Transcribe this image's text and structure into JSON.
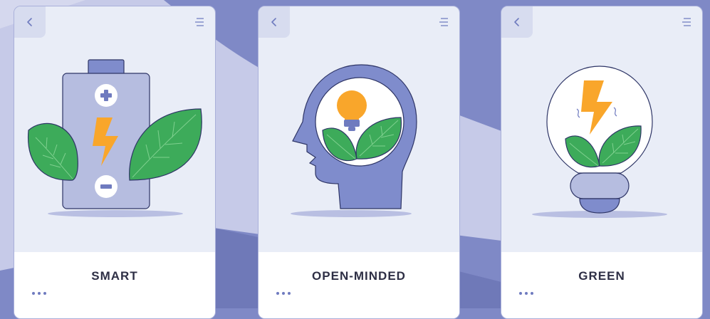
{
  "colors": {
    "background": "#7f89c6",
    "background_light": "#c6cae8",
    "card": "#e9edf7",
    "card_border": "#a9b0da",
    "accent": "#6f7bbf",
    "leaf": "#3dab5a",
    "bolt": "#f9a62b",
    "title": "#2e2f45"
  },
  "cards": [
    {
      "title": "SMART",
      "back_icon": "chevron-left-icon",
      "menu_icon": "menu-lines-icon",
      "more_icon": "more-dots-icon",
      "illustration": "battery-with-leaves"
    },
    {
      "title": "OPEN-MINDED",
      "back_icon": "chevron-left-icon",
      "menu_icon": "menu-lines-icon",
      "more_icon": "more-dots-icon",
      "illustration": "head-with-lightbulb-and-leaves"
    },
    {
      "title": "GREEN",
      "back_icon": "chevron-left-icon",
      "menu_icon": "menu-lines-icon",
      "more_icon": "more-dots-icon",
      "illustration": "lightbulb-with-bolt-and-leaves"
    }
  ]
}
